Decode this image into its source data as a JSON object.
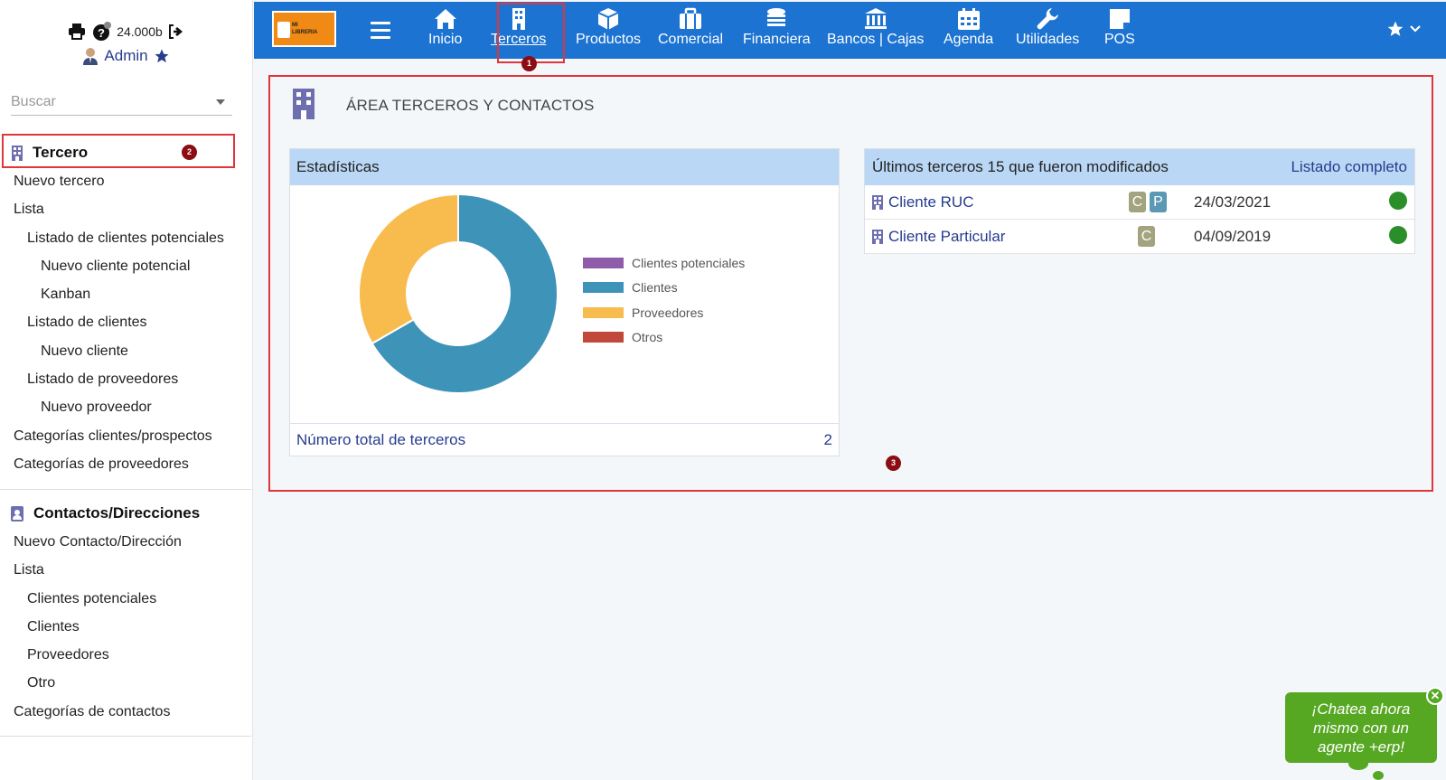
{
  "user": {
    "credits": "24.000b",
    "name": "Admin"
  },
  "search": {
    "placeholder": "Buscar"
  },
  "sidebar": {
    "tercero": {
      "title": "Tercero",
      "items": [
        {
          "label": "Nuevo tercero",
          "level": 1
        },
        {
          "label": "Lista",
          "level": 1
        },
        {
          "label": "Listado de clientes potenciales",
          "level": 2
        },
        {
          "label": "Nuevo cliente potencial",
          "level": 3
        },
        {
          "label": "Kanban",
          "level": 3
        },
        {
          "label": "Listado de clientes",
          "level": 2
        },
        {
          "label": "Nuevo cliente",
          "level": 3
        },
        {
          "label": "Listado de proveedores",
          "level": 2
        },
        {
          "label": "Nuevo proveedor",
          "level": 3
        },
        {
          "label": "Categorías clientes/prospectos",
          "level": 1
        },
        {
          "label": "Categorías de proveedores",
          "level": 1
        }
      ]
    },
    "contactos": {
      "title": "Contactos/Direcciones",
      "items": [
        {
          "label": "Nuevo Contacto/Dirección",
          "level": 1
        },
        {
          "label": "Lista",
          "level": 1
        },
        {
          "label": "Clientes potenciales",
          "level": 2
        },
        {
          "label": "Clientes",
          "level": 2
        },
        {
          "label": "Proveedores",
          "level": 2
        },
        {
          "label": "Otro",
          "level": 2
        },
        {
          "label": "Categorías de contactos",
          "level": 1
        }
      ]
    }
  },
  "logo": {
    "line1": "MI",
    "line2": "LIBRERIA"
  },
  "nav": [
    {
      "label": "Inicio",
      "icon": "home-icon"
    },
    {
      "label": "Terceros",
      "icon": "building-icon"
    },
    {
      "label": "Productos",
      "icon": "box-icon"
    },
    {
      "label": "Comercial",
      "icon": "briefcase-icon"
    },
    {
      "label": "Financiera",
      "icon": "coins-icon"
    },
    {
      "label": "Bancos | Cajas",
      "icon": "bank-icon"
    },
    {
      "label": "Agenda",
      "icon": "calendar-icon"
    },
    {
      "label": "Utilidades",
      "icon": "wrench-icon"
    },
    {
      "label": "POS",
      "icon": "sticky-note-icon"
    }
  ],
  "area": {
    "title": "ÁREA TERCEROS Y CONTACTOS"
  },
  "stats": {
    "title": "Estadísticas",
    "total_label": "Número total de terceros",
    "total_value": "2"
  },
  "chart_data": {
    "type": "pie",
    "categories": [
      "Clientes potenciales",
      "Clientes",
      "Proveedores",
      "Otros"
    ],
    "values": [
      0,
      2,
      1,
      0
    ],
    "colors": [
      "#8e5ca9",
      "#3d93b8",
      "#f8bc4e",
      "#c0493c"
    ],
    "legend_position": "right"
  },
  "recent": {
    "title": "Últimos terceros 15 que fueron modificados",
    "link": "Listado completo",
    "rows": [
      {
        "name": "Cliente RUC",
        "badges": [
          "C",
          "P"
        ],
        "date": "24/03/2021",
        "status_color": "#2a8f2a"
      },
      {
        "name": "Cliente Particular",
        "badges": [
          "C"
        ],
        "date": "04/09/2019",
        "status_color": "#2a8f2a"
      }
    ]
  },
  "annotations": [
    "1",
    "2",
    "3"
  ],
  "chat": {
    "line1": "¡Chatea ahora",
    "line2": "mismo con un",
    "line3": "agente +erp!",
    "close": "✕"
  },
  "colors": {
    "topbar": "#1c73d1",
    "panel_head": "#bad8f5",
    "link": "#263c8e",
    "annotation_box": "#e0353b"
  }
}
